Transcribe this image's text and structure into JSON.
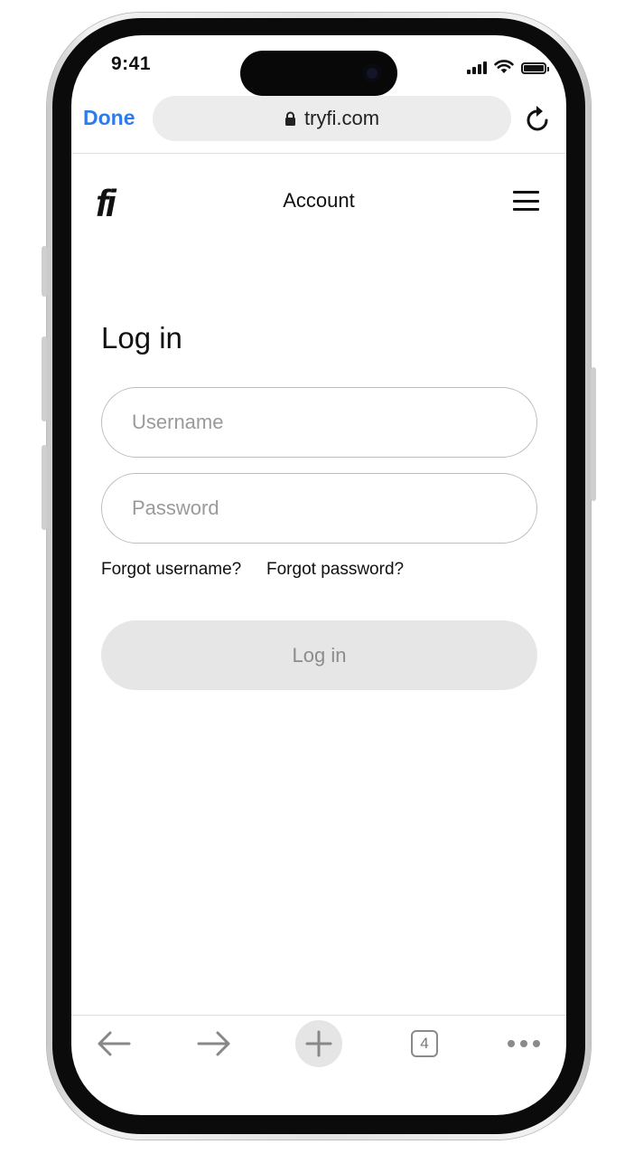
{
  "status_bar": {
    "time": "9:41"
  },
  "browser": {
    "done_label": "Done",
    "url": "tryfi.com",
    "icons": {
      "lock": "lock-icon",
      "reload": "reload-icon"
    },
    "accent_color": "#2f7ce8"
  },
  "site_header": {
    "logo_text": "fi",
    "title": "Account",
    "menu_icon": "hamburger-menu-icon"
  },
  "login_form": {
    "heading": "Log in",
    "username": {
      "placeholder": "Username",
      "value": ""
    },
    "password": {
      "placeholder": "Password",
      "value": ""
    },
    "forgot_username": "Forgot username?",
    "forgot_password": "Forgot password?",
    "submit_label": "Log in",
    "submit_enabled": false
  },
  "toolbar": {
    "items": [
      "back-arrow-icon",
      "forward-arrow-icon",
      "new-tab-plus-icon",
      "tabs-count-icon",
      "more-options-icon"
    ],
    "tab_count": "4"
  }
}
